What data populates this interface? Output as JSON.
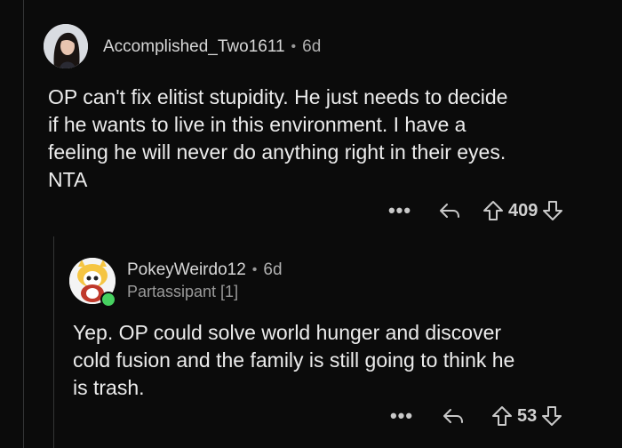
{
  "comment1": {
    "username": "Accomplished_Two1611",
    "separator": "•",
    "age": "6d",
    "body": "OP can't fix elitist stupidity.  He just needs to decide\nif he wants to live in this environment.  I have a\nfeeling he will never do anything right in their eyes.\nNTA",
    "score": "409",
    "more_label": "•••"
  },
  "comment2": {
    "username": "PokeyWeirdo12",
    "separator": "•",
    "age": "6d",
    "flair": "Partassipant [1]",
    "body": "Yep. OP could solve world hunger and discover\ncold fusion and the family is still going to think he\nis trash.",
    "score": "53",
    "more_label": "•••"
  },
  "icons": [
    "reply-icon",
    "upvote-icon",
    "downvote-icon",
    "more-options-icon",
    "avatar-icon",
    "online-status-icon"
  ],
  "colors": {
    "background": "#0b0b0b",
    "text": "#ececec",
    "muted": "#9a9a9a",
    "online": "#46d160"
  }
}
